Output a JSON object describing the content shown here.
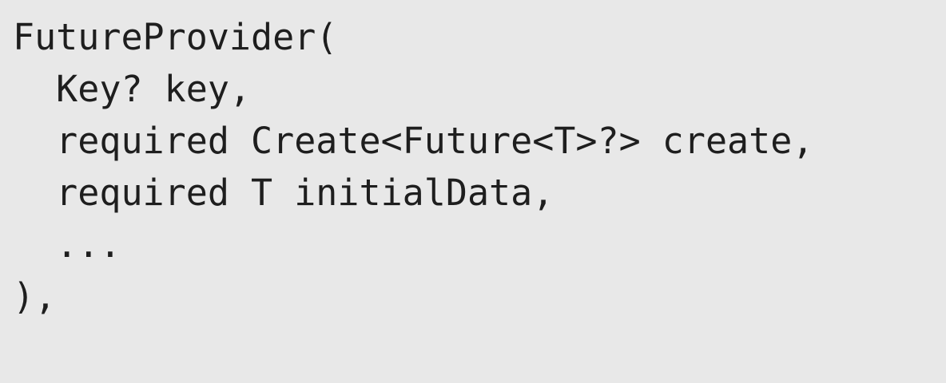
{
  "code": {
    "lines": [
      "FutureProvider(",
      "  Key? key,",
      "  required Create<Future<T>?> create,",
      "  required T initialData,",
      "  ...",
      "),"
    ]
  },
  "colors": {
    "background": "#e8e8e8",
    "text": "#1e1e1e"
  }
}
